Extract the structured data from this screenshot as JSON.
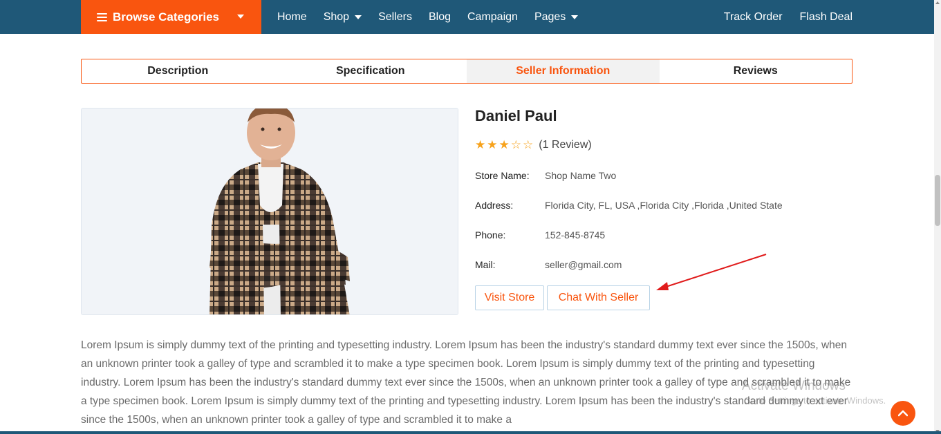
{
  "nav": {
    "browse_label": "Browse Categories",
    "links": [
      "Home",
      "Shop",
      "Sellers",
      "Blog",
      "Campaign",
      "Pages"
    ],
    "right_links": [
      "Track Order",
      "Flash Deal"
    ]
  },
  "tabs": [
    "Description",
    "Specification",
    "Seller Information",
    "Reviews"
  ],
  "active_tab": "Seller Information",
  "seller": {
    "name": "Daniel Paul",
    "rating_stars": 3,
    "rating_max": 5,
    "review_count": "(1 Review)",
    "store_label": "Store Name:",
    "store_value": "Shop Name Two",
    "address_label": "Address:",
    "address_value": "Florida City, FL, USA ,Florida City ,Florida ,United State",
    "phone_label": "Phone:",
    "phone_value": "152-845-8745",
    "mail_label": "Mail:",
    "mail_value": "seller@gmail.com",
    "visit_label": "Visit Store",
    "chat_label": "Chat With Seller"
  },
  "description": "Lorem Ipsum is simply dummy text of the printing and typesetting industry. Lorem Ipsum has been the industry's standard dummy text ever since the 1500s, when an unknown printer took a galley of type and scrambled it to make a type specimen book. Lorem Ipsum is simply dummy text of the printing and typesetting industry. Lorem Ipsum has been the industry's standard dummy text ever since the 1500s, when an unknown printer took a galley of type and scrambled it to make a type specimen book. Lorem Ipsum is simply dummy text of the printing and typesetting industry. Lorem Ipsum has been the industry's standard dummy text ever since the 1500s, when an unknown printer took a galley of type and scrambled it to make a",
  "watermark": {
    "line1": "Activate Windows",
    "line2": "Go to Settings to activate Windows."
  },
  "colors": {
    "accent": "#f9550f",
    "nav_bg": "#1f5878",
    "star": "#f7a21b",
    "arrow": "#e01b1b"
  },
  "icons": {
    "menu": "hamburger-icon",
    "scroll_top": "arrow-up-icon",
    "star": "star-icon"
  }
}
